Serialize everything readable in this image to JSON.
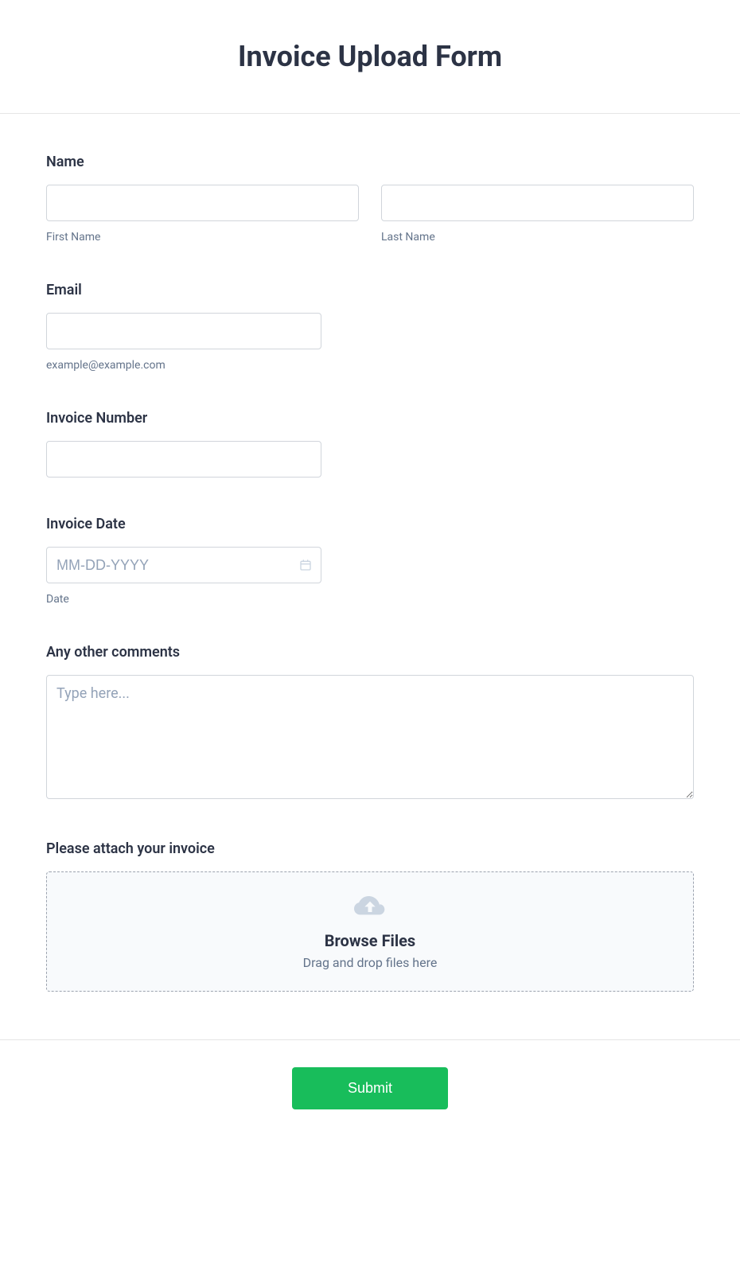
{
  "header": {
    "title": "Invoice Upload Form"
  },
  "name": {
    "label": "Name",
    "first_sub": "First Name",
    "last_sub": "Last Name",
    "first_value": "",
    "last_value": ""
  },
  "email": {
    "label": "Email",
    "sub": "example@example.com",
    "value": ""
  },
  "invoice_number": {
    "label": "Invoice Number",
    "value": ""
  },
  "invoice_date": {
    "label": "Invoice Date",
    "placeholder": "MM-DD-YYYY",
    "sub": "Date",
    "value": ""
  },
  "comments": {
    "label": "Any other comments",
    "placeholder": "Type here...",
    "value": ""
  },
  "attach": {
    "label": "Please attach your invoice",
    "browse": "Browse Files",
    "hint": "Drag and drop files here"
  },
  "submit": {
    "label": "Submit"
  }
}
